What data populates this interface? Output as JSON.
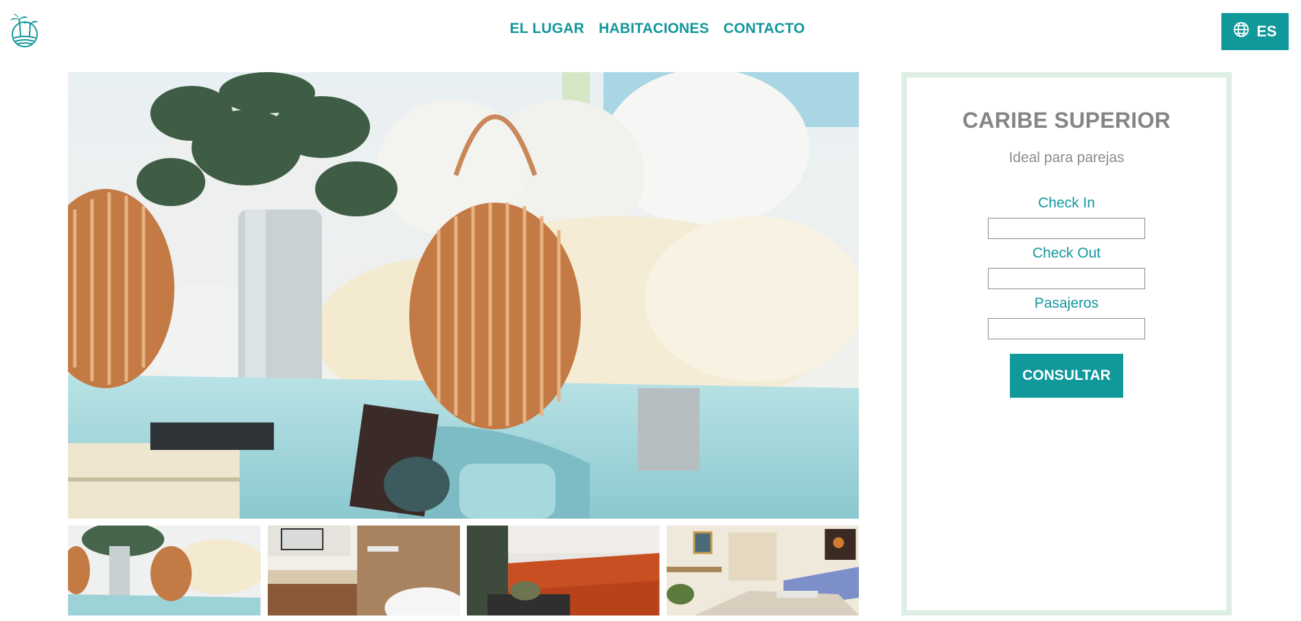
{
  "header": {
    "logo_icon": "palm-island-logo-icon",
    "nav": [
      {
        "label": "EL LUGAR"
      },
      {
        "label": "HABITACIONES"
      },
      {
        "label": "CONTACTO"
      }
    ],
    "language": {
      "icon": "globe-icon",
      "label": "ES"
    }
  },
  "gallery": {
    "main_image": "living-room-rattan-lanterns-photo",
    "thumbnails": [
      {
        "name": "living-room-rattan-lanterns-thumb"
      },
      {
        "name": "bathroom-wood-vanity-thumb"
      },
      {
        "name": "orange-sofa-lounge-thumb"
      },
      {
        "name": "living-dining-room-thumb"
      }
    ]
  },
  "booking": {
    "title": "CARIBE SUPERIOR",
    "subtitle": "Ideal para parejas",
    "check_in_label": "Check In",
    "check_in_value": "",
    "check_out_label": "Check Out",
    "check_out_value": "",
    "guests_label": "Pasajeros",
    "guests_value": "",
    "submit_label": "CONSULTAR"
  },
  "colors": {
    "accent": "#10989a",
    "panel_border": "#deeee4",
    "title_gray": "#858585"
  }
}
